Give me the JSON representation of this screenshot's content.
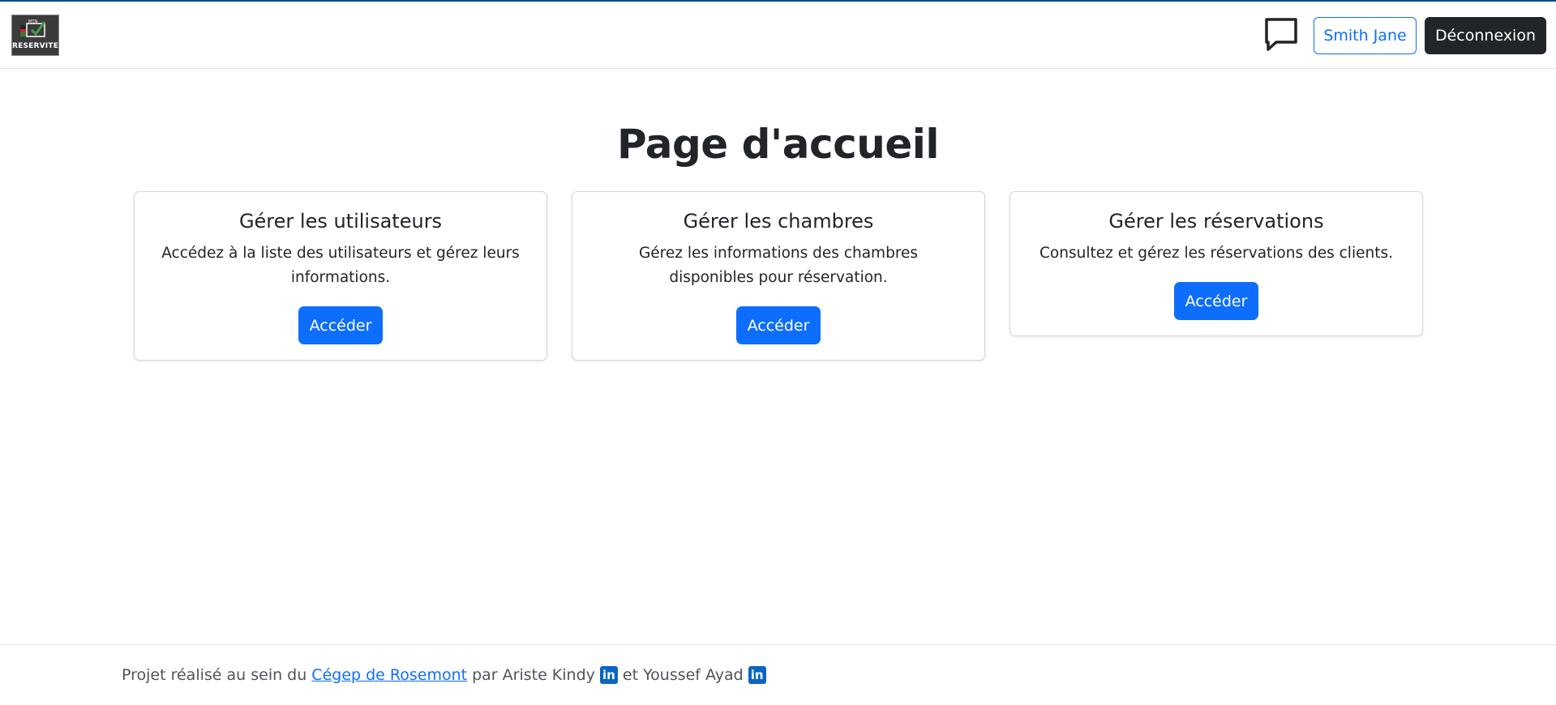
{
  "header": {
    "logo_text": "RESERVITE",
    "user_label": "Smith Jane",
    "logout_label": "Déconnexion",
    "chat_icon": "chat-bubble-icon"
  },
  "main": {
    "title": "Page d'accueil",
    "cards": [
      {
        "title": "Gérer les utilisateurs",
        "text": "Accédez à la liste des utilisateurs et gérez leurs informations.",
        "button": "Accéder"
      },
      {
        "title": "Gérer les chambres",
        "text": "Gérez les informations des chambres disponibles pour réservation.",
        "button": "Accéder"
      },
      {
        "title": "Gérer les réservations",
        "text": "Consultez et gérez les réservations des clients.",
        "button": "Accéder"
      }
    ]
  },
  "footer": {
    "prefix": "Projet réalisé au sein du",
    "link_text": "Cégep de Rosemont",
    "middle": "par Ariste Kindy",
    "connector": "et Youssef Ayad",
    "linkedin_glyph": "in"
  },
  "colors": {
    "primary": "#0d6efd",
    "dark": "#212529",
    "linkedin": "#0a66c2",
    "top_line": "#0b4f8a"
  }
}
